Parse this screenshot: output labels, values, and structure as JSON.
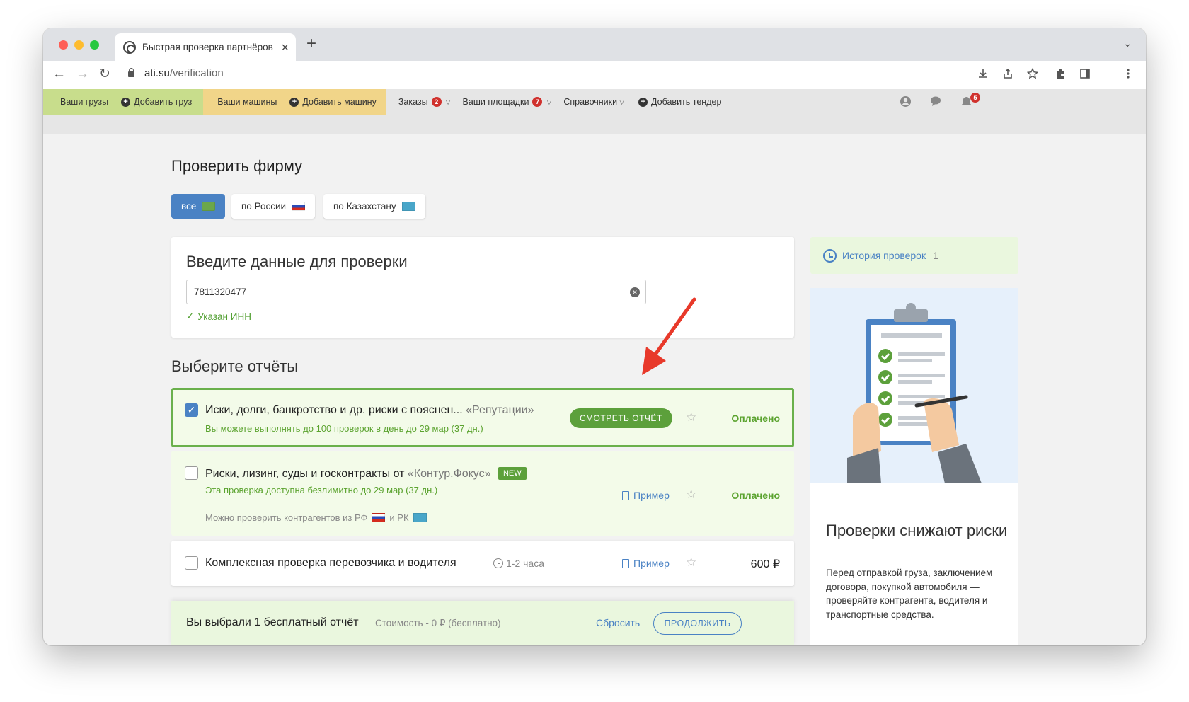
{
  "browser": {
    "tab_title": "Быстрая проверка партнёров",
    "tab_close": "×",
    "new_tab": "+",
    "tabs_menu": "⌄",
    "url_domain": "ati.su",
    "url_path": "/verification",
    "nav": {
      "back": "←",
      "forward": "→",
      "reload": "↻"
    },
    "toolbar_icons": [
      "download-icon",
      "share-icon",
      "bookmark-star-icon",
      "extensions-icon",
      "sidebar-icon",
      "menu-icon"
    ]
  },
  "site_nav": {
    "your_loads": "Ваши грузы",
    "add_load": "Добавить груз",
    "your_trucks": "Ваши машины",
    "add_truck": "Добавить машину",
    "orders": "Заказы",
    "orders_badge": "2",
    "your_platforms": "Ваши площадки",
    "platforms_badge": "7",
    "references": "Справочники",
    "add_tender": "Добавить тендер",
    "notifications_badge": "5"
  },
  "page": {
    "title": "Проверить фирму",
    "filters": [
      {
        "label": "все",
        "active": true
      },
      {
        "label": "по России",
        "active": false
      },
      {
        "label": "по Казахстану",
        "active": false
      }
    ]
  },
  "input_card": {
    "title": "Введите данные для проверки",
    "value": "7811320477",
    "validation": "Указан ИНН"
  },
  "reports": {
    "title": "Выберите отчёты",
    "items": [
      {
        "checked": true,
        "title": "Иски, долги, банкротство и др. риски с пояснен...",
        "source": "«Репутации»",
        "sub": "Вы можете выполнять до 100 проверок в день до 29 мар (37 дн.)",
        "button": "СМОТРЕТЬ ОТЧЁТ",
        "status": "Оплачено"
      },
      {
        "checked": false,
        "title": "Риски, лизинг, суды и госконтракты от",
        "source": "«Контур.Фокус»",
        "badge": "NEW",
        "sub": "Эта проверка доступна безлимитно до 29 мар (37 дн.)",
        "note_prefix": "Можно проверить контрагентов из РФ",
        "note_and": "и РК",
        "example": "Пример",
        "status": "Оплачено"
      },
      {
        "checked": false,
        "title": "Комплексная проверка перевозчика и водителя",
        "time": "1-2 часа",
        "example": "Пример",
        "price": "600 ₽"
      }
    ]
  },
  "bottom_bar": {
    "summary": "Вы выбрали 1 бесплатный отчёт",
    "cost": "Стоимость - 0 ₽ (бесплатно)",
    "reset": "Сбросить",
    "continue": "ПРОДОЛЖИТЬ"
  },
  "sidebar": {
    "history_label": "История проверок",
    "history_count": "1",
    "promo_title": "Проверки снижают риски",
    "promo_text": "Перед отправкой груза, заключением договора, покупкой автомобиля — проверяйте контрагента, водителя и транспортные средства."
  },
  "colors": {
    "accent_blue": "#4a82c4",
    "accent_green": "#5ca03b",
    "loads_bg": "#c8dd8c",
    "trucks_bg": "#f1d589",
    "arrow_red": "#e8392a"
  }
}
